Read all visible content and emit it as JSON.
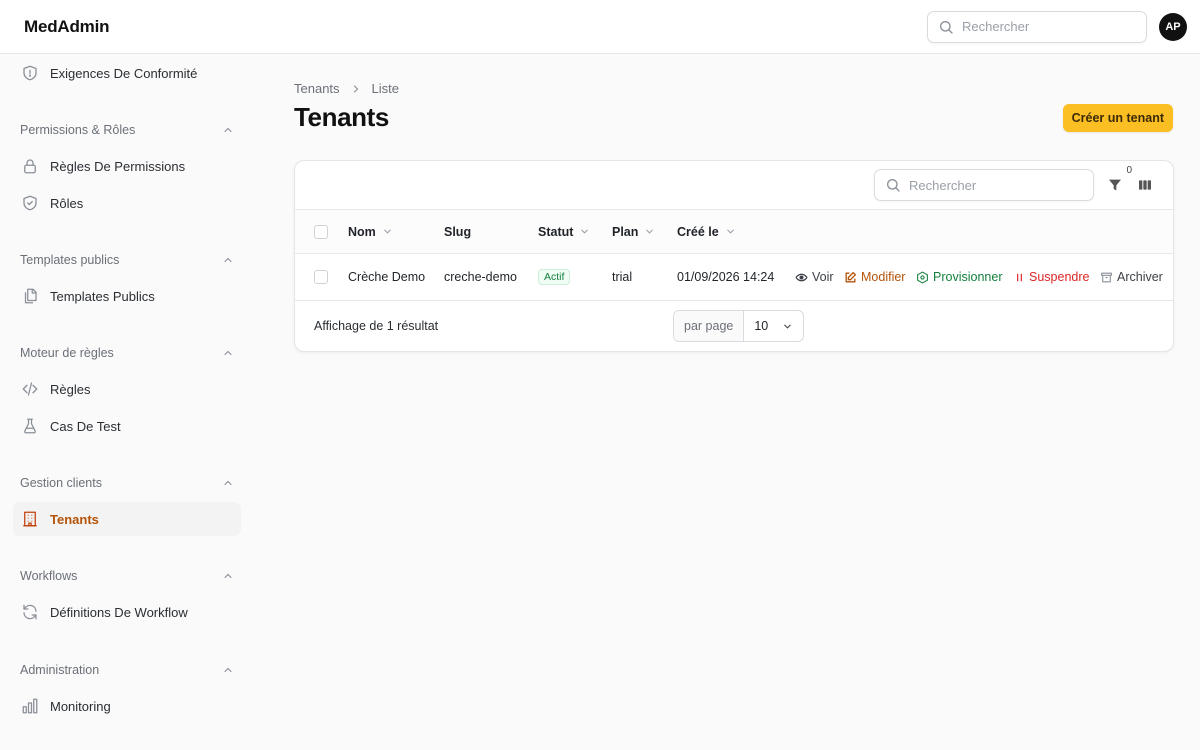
{
  "app": {
    "title": "MedAdmin",
    "avatar_initials": "AP"
  },
  "topbar": {
    "search_placeholder": "Rechercher"
  },
  "sidebar": {
    "top_item": {
      "label": "Exigences De Conformité",
      "icon": "shield-alert-icon"
    },
    "groups": [
      {
        "label": "Permissions & Rôles",
        "items": [
          {
            "label": "Règles De Permissions",
            "icon": "lock-icon"
          },
          {
            "label": "Rôles",
            "icon": "shield-check-icon"
          }
        ]
      },
      {
        "label": "Templates publics",
        "items": [
          {
            "label": "Templates Publics",
            "icon": "documents-icon"
          }
        ]
      },
      {
        "label": "Moteur de règles",
        "items": [
          {
            "label": "Règles",
            "icon": "code-icon"
          },
          {
            "label": "Cas De Test",
            "icon": "beaker-icon"
          }
        ]
      },
      {
        "label": "Gestion clients",
        "items": [
          {
            "label": "Tenants",
            "icon": "building-icon",
            "active": true
          }
        ]
      },
      {
        "label": "Workflows",
        "items": [
          {
            "label": "Définitions De Workflow",
            "icon": "refresh-icon"
          }
        ]
      },
      {
        "label": "Administration",
        "items": [
          {
            "label": "Monitoring",
            "icon": "bar-chart-icon"
          }
        ]
      }
    ]
  },
  "breadcrumb": {
    "parent": "Tenants",
    "current": "Liste"
  },
  "page": {
    "title": "Tenants",
    "create_label": "Créer un tenant"
  },
  "table": {
    "search_placeholder": "Rechercher",
    "filter_count": "0",
    "columns": {
      "name": "Nom",
      "slug": "Slug",
      "status": "Statut",
      "plan": "Plan",
      "created": "Créé le"
    },
    "rows": [
      {
        "name": "Crèche Demo",
        "slug": "creche-demo",
        "status": "Actif",
        "plan": "trial",
        "created": "01/09/2026 14:24"
      }
    ],
    "actions": {
      "view": "Voir",
      "edit": "Modifier",
      "provision": "Provisionner",
      "suspend": "Suspendre",
      "archive": "Archiver"
    },
    "footer": {
      "summary": "Affichage de 1 résultat",
      "per_page_label": "par page",
      "per_page_value": "10"
    }
  },
  "colors": {
    "accent": "#fbbf24",
    "active_nav": "#b45309",
    "success": "#15803d",
    "danger": "#dc2626"
  }
}
